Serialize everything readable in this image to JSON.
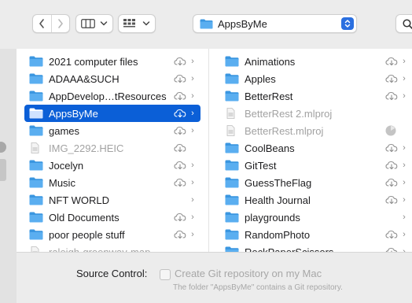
{
  "toolbar": {
    "location_name": "AppsByMe"
  },
  "left_column": [
    {
      "label": "2021 computer files",
      "kind": "folder",
      "cloud": true,
      "chevron": true
    },
    {
      "label": "ADAAA&SUCH",
      "kind": "folder",
      "cloud": true,
      "chevron": true
    },
    {
      "label": "AppDevelop…tResources",
      "kind": "folder",
      "cloud": true,
      "chevron": true
    },
    {
      "label": "AppsByMe",
      "kind": "folder",
      "cloud": true,
      "chevron": true,
      "selected": true
    },
    {
      "label": "games",
      "kind": "folder",
      "cloud": true,
      "chevron": true
    },
    {
      "label": "IMG_2292.HEIC",
      "kind": "file",
      "cloud": true,
      "chevron": false,
      "dim": true
    },
    {
      "label": "Jocelyn",
      "kind": "folder",
      "cloud": true,
      "chevron": true
    },
    {
      "label": "Music",
      "kind": "folder",
      "cloud": true,
      "chevron": true
    },
    {
      "label": "NFT WORLD",
      "kind": "folder",
      "cloud": false,
      "chevron": true
    },
    {
      "label": "Old Documents",
      "kind": "folder",
      "cloud": true,
      "chevron": true
    },
    {
      "label": "poor people stuff",
      "kind": "folder",
      "cloud": true,
      "chevron": true
    },
    {
      "label": "raleigh-greenway-map",
      "kind": "file",
      "cloud": false,
      "chevron": false,
      "dim": true
    }
  ],
  "right_column": [
    {
      "label": "Animations",
      "kind": "folder",
      "cloud": true,
      "chevron": true
    },
    {
      "label": "Apples",
      "kind": "folder",
      "cloud": true,
      "chevron": true
    },
    {
      "label": "BetterRest",
      "kind": "folder",
      "cloud": true,
      "chevron": true
    },
    {
      "label": "BetterRest 2.mlproj",
      "kind": "file",
      "cloud": false,
      "chevron": false,
      "dim": true
    },
    {
      "label": "BetterRest.mlproj",
      "kind": "file",
      "cloud": false,
      "chevron": false,
      "dim": true,
      "pending": true
    },
    {
      "label": "CoolBeans",
      "kind": "folder",
      "cloud": true,
      "chevron": true
    },
    {
      "label": "GitTest",
      "kind": "folder",
      "cloud": true,
      "chevron": true
    },
    {
      "label": "GuessTheFlag",
      "kind": "folder",
      "cloud": true,
      "chevron": true
    },
    {
      "label": "Health Journal",
      "kind": "folder",
      "cloud": true,
      "chevron": true
    },
    {
      "label": "playgrounds",
      "kind": "folder",
      "cloud": false,
      "chevron": true
    },
    {
      "label": "RandomPhoto",
      "kind": "folder",
      "cloud": true,
      "chevron": true
    },
    {
      "label": "RockPaperScissors",
      "kind": "folder",
      "cloud": true,
      "chevron": true
    }
  ],
  "source_control": {
    "label": "Source Control:",
    "checkbox_label": "Create Git repository on my Mac",
    "note": "The folder \"AppsByMe\" contains a Git repository."
  },
  "colors": {
    "accent": "#0b5fd7",
    "folder": "#3a96e0"
  }
}
